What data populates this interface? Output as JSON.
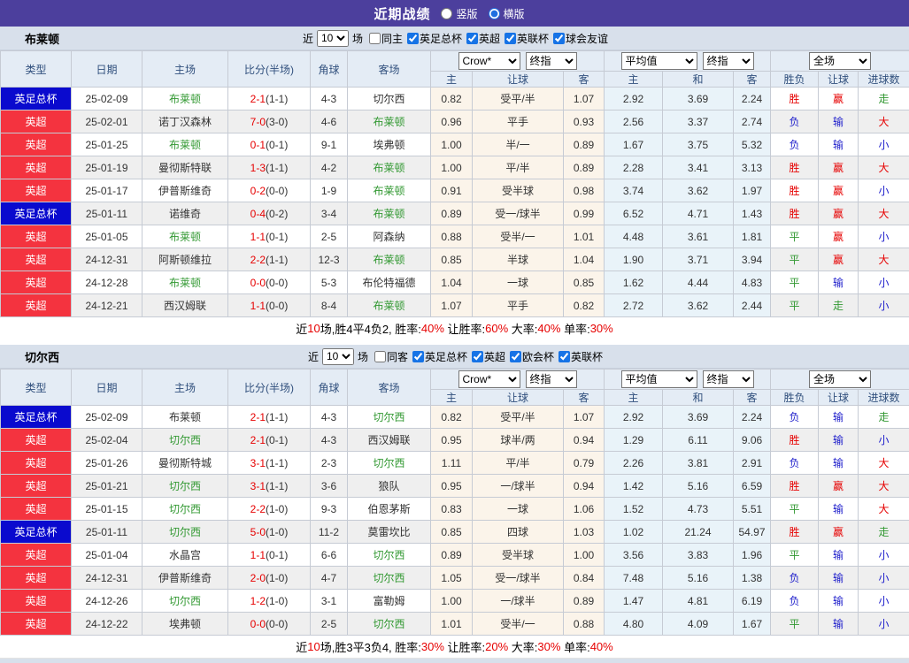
{
  "colors": {
    "titlebar_purple": "#4c3f9d",
    "cup_badge_blue": "#0a0ace",
    "league_badge_red": "#f4333f",
    "focal_team_green": "#339933",
    "score_red": "#e60000",
    "lose_blue": "#2222cc",
    "crow_column_cream": "#fbf4ea",
    "average_column_blue": "#e9f3f9"
  },
  "titlebar": {
    "title": "近期战绩",
    "radios": [
      {
        "label": "竖版",
        "checked": false
      },
      {
        "label": "横版",
        "checked": true
      }
    ]
  },
  "table_header": {
    "cols": [
      "类型",
      "日期",
      "主场",
      "比分(半场)",
      "角球",
      "客场"
    ],
    "odds_cols": [
      "主",
      "让球",
      "客"
    ],
    "avg_cols": [
      "主",
      "和",
      "客"
    ],
    "result_cols": [
      "胜负",
      "让球",
      "进球数"
    ],
    "selects": {
      "bookmaker": "Crow*",
      "final1": "终指",
      "average": "平均值",
      "final2": "终指",
      "fulltime": "全场"
    }
  },
  "sections": [
    {
      "team": "布莱顿",
      "filter": {
        "near": "近",
        "count": "10",
        "games": "场",
        "venue": {
          "label": "同主",
          "checked": false
        },
        "leagues": [
          {
            "label": "英足总杯",
            "checked": true
          },
          {
            "label": "英超",
            "checked": true
          },
          {
            "label": "英联杯",
            "checked": true
          },
          {
            "label": "球会友谊",
            "checked": true
          }
        ]
      },
      "rows": [
        {
          "type": "英足总杯",
          "kind": "cup",
          "date": "25-02-09",
          "home": "布莱顿",
          "ft": "2-1",
          "ht": "(1-1)",
          "corner": "4-3",
          "away": "切尔西",
          "h": "0.82",
          "hcap": "受平/半",
          "a": "1.07",
          "ah": "2.92",
          "ad": "3.69",
          "aa": "2.24",
          "wdl": "胜",
          "hr": "赢",
          "gr": "走"
        },
        {
          "type": "英超",
          "kind": "league",
          "date": "25-02-01",
          "home": "诺丁汉森林",
          "ft": "7-0",
          "ht": "(3-0)",
          "corner": "4-6",
          "away": "布莱顿",
          "h": "0.96",
          "hcap": "平手",
          "a": "0.93",
          "ah": "2.56",
          "ad": "3.37",
          "aa": "2.74",
          "wdl": "负",
          "hr": "输",
          "gr": "大"
        },
        {
          "type": "英超",
          "kind": "league",
          "date": "25-01-25",
          "home": "布莱顿",
          "ft": "0-1",
          "ht": "(0-1)",
          "corner": "9-1",
          "away": "埃弗顿",
          "h": "1.00",
          "hcap": "半/一",
          "a": "0.89",
          "ah": "1.67",
          "ad": "3.75",
          "aa": "5.32",
          "wdl": "负",
          "hr": "输",
          "gr": "小"
        },
        {
          "type": "英超",
          "kind": "league",
          "date": "25-01-19",
          "home": "曼彻斯特联",
          "ft": "1-3",
          "ht": "(1-1)",
          "corner": "4-2",
          "away": "布莱顿",
          "h": "1.00",
          "hcap": "平/半",
          "a": "0.89",
          "ah": "2.28",
          "ad": "3.41",
          "aa": "3.13",
          "wdl": "胜",
          "hr": "赢",
          "gr": "大"
        },
        {
          "type": "英超",
          "kind": "league",
          "date": "25-01-17",
          "home": "伊普斯维奇",
          "ft": "0-2",
          "ht": "(0-0)",
          "corner": "1-9",
          "away": "布莱顿",
          "h": "0.91",
          "hcap": "受半球",
          "a": "0.98",
          "ah": "3.74",
          "ad": "3.62",
          "aa": "1.97",
          "wdl": "胜",
          "hr": "赢",
          "gr": "小"
        },
        {
          "type": "英足总杯",
          "kind": "cup",
          "date": "25-01-11",
          "home": "诺维奇",
          "ft": "0-4",
          "ht": "(0-2)",
          "corner": "3-4",
          "away": "布莱顿",
          "h": "0.89",
          "hcap": "受一/球半",
          "a": "0.99",
          "ah": "6.52",
          "ad": "4.71",
          "aa": "1.43",
          "wdl": "胜",
          "hr": "赢",
          "gr": "大"
        },
        {
          "type": "英超",
          "kind": "league",
          "date": "25-01-05",
          "home": "布莱顿",
          "ft": "1-1",
          "ht": "(0-1)",
          "corner": "2-5",
          "away": "阿森纳",
          "h": "0.88",
          "hcap": "受半/一",
          "a": "1.01",
          "ah": "4.48",
          "ad": "3.61",
          "aa": "1.81",
          "wdl": "平",
          "hr": "赢",
          "gr": "小"
        },
        {
          "type": "英超",
          "kind": "league",
          "date": "24-12-31",
          "home": "阿斯顿维拉",
          "ft": "2-2",
          "ht": "(1-1)",
          "corner": "12-3",
          "away": "布莱顿",
          "h": "0.85",
          "hcap": "半球",
          "a": "1.04",
          "ah": "1.90",
          "ad": "3.71",
          "aa": "3.94",
          "wdl": "平",
          "hr": "赢",
          "gr": "大"
        },
        {
          "type": "英超",
          "kind": "league",
          "date": "24-12-28",
          "home": "布莱顿",
          "ft": "0-0",
          "ht": "(0-0)",
          "corner": "5-3",
          "away": "布伦特福德",
          "h": "1.04",
          "hcap": "一球",
          "a": "0.85",
          "ah": "1.62",
          "ad": "4.44",
          "aa": "4.83",
          "wdl": "平",
          "hr": "输",
          "gr": "小"
        },
        {
          "type": "英超",
          "kind": "league",
          "date": "24-12-21",
          "home": "西汉姆联",
          "ft": "1-1",
          "ht": "(0-0)",
          "corner": "8-4",
          "away": "布莱顿",
          "h": "1.07",
          "hcap": "平手",
          "a": "0.82",
          "ah": "2.72",
          "ad": "3.62",
          "aa": "2.44",
          "wdl": "平",
          "hr": "走",
          "gr": "小"
        }
      ],
      "summary": [
        {
          "t": "近",
          "r": false
        },
        {
          "t": "10",
          "r": true
        },
        {
          "t": "场,胜4平4负2, 胜率:",
          "r": false
        },
        {
          "t": "40%",
          "r": true
        },
        {
          "t": " 让胜率:",
          "r": false
        },
        {
          "t": "60%",
          "r": true
        },
        {
          "t": " 大率:",
          "r": false
        },
        {
          "t": "40%",
          "r": true
        },
        {
          "t": " 单率:",
          "r": false
        },
        {
          "t": "30%",
          "r": true
        }
      ]
    },
    {
      "team": "切尔西",
      "filter": {
        "near": "近",
        "count": "10",
        "games": "场",
        "venue": {
          "label": "同客",
          "checked": false
        },
        "leagues": [
          {
            "label": "英足总杯",
            "checked": true
          },
          {
            "label": "英超",
            "checked": true
          },
          {
            "label": "欧会杯",
            "checked": true
          },
          {
            "label": "英联杯",
            "checked": true
          }
        ]
      },
      "rows": [
        {
          "type": "英足总杯",
          "kind": "cup",
          "date": "25-02-09",
          "home": "布莱顿",
          "ft": "2-1",
          "ht": "(1-1)",
          "corner": "4-3",
          "away": "切尔西",
          "h": "0.82",
          "hcap": "受平/半",
          "a": "1.07",
          "ah": "2.92",
          "ad": "3.69",
          "aa": "2.24",
          "wdl": "负",
          "hr": "输",
          "gr": "走"
        },
        {
          "type": "英超",
          "kind": "league",
          "date": "25-02-04",
          "home": "切尔西",
          "ft": "2-1",
          "ht": "(0-1)",
          "corner": "4-3",
          "away": "西汉姆联",
          "h": "0.95",
          "hcap": "球半/两",
          "a": "0.94",
          "ah": "1.29",
          "ad": "6.11",
          "aa": "9.06",
          "wdl": "胜",
          "hr": "输",
          "gr": "小"
        },
        {
          "type": "英超",
          "kind": "league",
          "date": "25-01-26",
          "home": "曼彻斯特城",
          "ft": "3-1",
          "ht": "(1-1)",
          "corner": "2-3",
          "away": "切尔西",
          "h": "1.11",
          "hcap": "平/半",
          "a": "0.79",
          "ah": "2.26",
          "ad": "3.81",
          "aa": "2.91",
          "wdl": "负",
          "hr": "输",
          "gr": "大"
        },
        {
          "type": "英超",
          "kind": "league",
          "date": "25-01-21",
          "home": "切尔西",
          "ft": "3-1",
          "ht": "(1-1)",
          "corner": "3-6",
          "away": "狼队",
          "h": "0.95",
          "hcap": "一/球半",
          "a": "0.94",
          "ah": "1.42",
          "ad": "5.16",
          "aa": "6.59",
          "wdl": "胜",
          "hr": "赢",
          "gr": "大"
        },
        {
          "type": "英超",
          "kind": "league",
          "date": "25-01-15",
          "home": "切尔西",
          "ft": "2-2",
          "ht": "(1-0)",
          "corner": "9-3",
          "away": "伯恩茅斯",
          "h": "0.83",
          "hcap": "一球",
          "a": "1.06",
          "ah": "1.52",
          "ad": "4.73",
          "aa": "5.51",
          "wdl": "平",
          "hr": "输",
          "gr": "大"
        },
        {
          "type": "英足总杯",
          "kind": "cup",
          "date": "25-01-11",
          "home": "切尔西",
          "ft": "5-0",
          "ht": "(1-0)",
          "corner": "11-2",
          "away": "莫雷坎比",
          "h": "0.85",
          "hcap": "四球",
          "a": "1.03",
          "ah": "1.02",
          "ad": "21.24",
          "aa": "54.97",
          "wdl": "胜",
          "hr": "赢",
          "gr": "走"
        },
        {
          "type": "英超",
          "kind": "league",
          "date": "25-01-04",
          "home": "水晶宫",
          "ft": "1-1",
          "ht": "(0-1)",
          "corner": "6-6",
          "away": "切尔西",
          "h": "0.89",
          "hcap": "受半球",
          "a": "1.00",
          "ah": "3.56",
          "ad": "3.83",
          "aa": "1.96",
          "wdl": "平",
          "hr": "输",
          "gr": "小"
        },
        {
          "type": "英超",
          "kind": "league",
          "date": "24-12-31",
          "home": "伊普斯维奇",
          "ft": "2-0",
          "ht": "(1-0)",
          "corner": "4-7",
          "away": "切尔西",
          "h": "1.05",
          "hcap": "受一/球半",
          "a": "0.84",
          "ah": "7.48",
          "ad": "5.16",
          "aa": "1.38",
          "wdl": "负",
          "hr": "输",
          "gr": "小"
        },
        {
          "type": "英超",
          "kind": "league",
          "date": "24-12-26",
          "home": "切尔西",
          "ft": "1-2",
          "ht": "(1-0)",
          "corner": "3-1",
          "away": "富勒姆",
          "h": "1.00",
          "hcap": "一/球半",
          "a": "0.89",
          "ah": "1.47",
          "ad": "4.81",
          "aa": "6.19",
          "wdl": "负",
          "hr": "输",
          "gr": "小"
        },
        {
          "type": "英超",
          "kind": "league",
          "date": "24-12-22",
          "home": "埃弗顿",
          "ft": "0-0",
          "ht": "(0-0)",
          "corner": "2-5",
          "away": "切尔西",
          "h": "1.01",
          "hcap": "受半/一",
          "a": "0.88",
          "ah": "4.80",
          "ad": "4.09",
          "aa": "1.67",
          "wdl": "平",
          "hr": "输",
          "gr": "小"
        }
      ],
      "summary": [
        {
          "t": "近",
          "r": false
        },
        {
          "t": "10",
          "r": true
        },
        {
          "t": "场,胜3平3负4, 胜率:",
          "r": false
        },
        {
          "t": "30%",
          "r": true
        },
        {
          "t": " 让胜率:",
          "r": false
        },
        {
          "t": "20%",
          "r": true
        },
        {
          "t": " 大率:",
          "r": false
        },
        {
          "t": "30%",
          "r": true
        },
        {
          "t": " 单率:",
          "r": false
        },
        {
          "t": "40%",
          "r": true
        }
      ]
    }
  ]
}
